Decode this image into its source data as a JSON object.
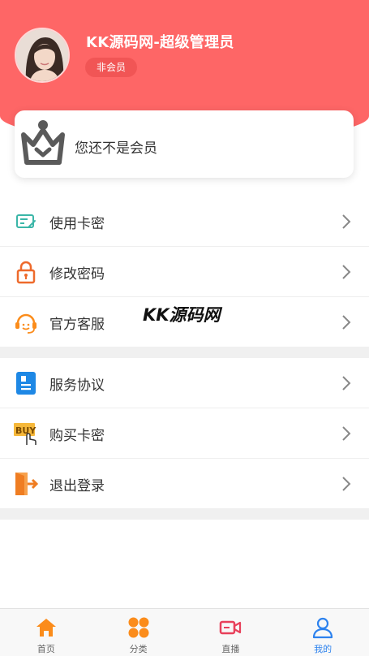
{
  "header": {
    "user_name": "KK源码网-超级管理员",
    "member_status": "非会员"
  },
  "vip_card": {
    "text": "您还不是会员"
  },
  "menu_group_1": [
    {
      "label": "使用卡密",
      "icon": "card-icon"
    },
    {
      "label": "修改密码",
      "icon": "lock-icon"
    },
    {
      "label": "官方客服",
      "icon": "headset-icon"
    }
  ],
  "menu_group_2": [
    {
      "label": "服务协议",
      "icon": "document-icon"
    },
    {
      "label": "购买卡密",
      "icon": "buy-icon"
    },
    {
      "label": "退出登录",
      "icon": "exit-icon"
    }
  ],
  "watermark": "KK源码网",
  "tabbar": [
    {
      "label": "首页",
      "icon": "home-icon"
    },
    {
      "label": "分类",
      "icon": "category-icon"
    },
    {
      "label": "直播",
      "icon": "live-icon"
    },
    {
      "label": "我的",
      "icon": "user-icon",
      "active": true
    }
  ],
  "colors": {
    "header_bg": "#fe6666",
    "active_tab": "#2d82ee",
    "orange": "#fb8c1b"
  }
}
